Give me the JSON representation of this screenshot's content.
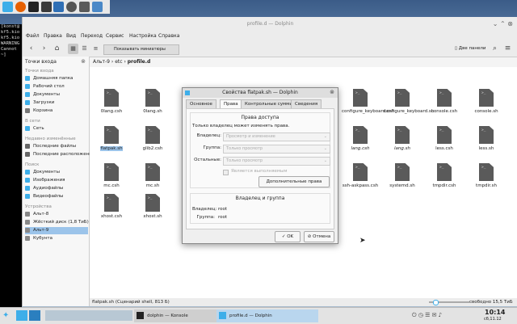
{
  "colors": {
    "accent": "#3daee9",
    "selection": "#9cc4ea",
    "file_icon": "#5a5a5a"
  },
  "konsole": {
    "lines": [
      "[konst@",
      "kf5.kio",
      "kf5.kio",
      "WARNING",
      "Cannot ",
      "~]"
    ]
  },
  "dolphin": {
    "title": "profile.d — Dolphin",
    "menu": [
      "Файл",
      "Правка",
      "Вид",
      "Переход",
      "Сервис",
      "Настройка",
      "Справка"
    ],
    "toolbar": {
      "show_preview": "Показывать миниатюры",
      "split": "Две панели"
    },
    "sidebar": {
      "places_header": "Точки входа",
      "places": [
        "Домашняя папка",
        "Рабочий стол",
        "Документы",
        "Загрузки",
        "Корзина"
      ],
      "network_header": "В сети",
      "network": [
        "Сеть"
      ],
      "recent_header": "Недавно изменённые",
      "recent": [
        "Последние файлы",
        "Последние расположения"
      ],
      "search_header": "Поиск",
      "search": [
        "Документы",
        "Изображения",
        "Аудиофайлы",
        "Видеофайлы"
      ],
      "devices_header": "Устройства",
      "devices": [
        "Альт-8",
        "Жёсткий диск (1,8 ТиБ)",
        "Альт-9",
        "Кубунта"
      ]
    },
    "breadcrumb": [
      "Альт-9",
      "etc",
      "profile.d"
    ],
    "files_row1": [
      "0lang.csh",
      "0lang.sh",
      "",
      "",
      "",
      "",
      "configure_keyboard.csh",
      "configure_keyboard.sh",
      "console.csh",
      "console.sh"
    ],
    "files_row2": [
      "flatpak.sh",
      "glib2.csh",
      "",
      "",
      "",
      "",
      "lang.csh",
      "lang.sh",
      "less.csh",
      "less.sh"
    ],
    "files_row3": [
      "mc.csh",
      "mc.sh",
      "",
      "",
      "",
      "",
      "ssh-askpass.csh",
      "systemd.sh",
      "tmpdir.csh",
      "tmpdir.sh"
    ],
    "files_row4": [
      "xhost.csh",
      "xhost.sh"
    ],
    "status_left": "flatpak.sh (Сценарий shell, 813 Б)",
    "status_right": "свободно 15,5 ТиБ"
  },
  "dialog": {
    "title": "Свойства flatpak.sh — Dolphin",
    "tabs": [
      "Основное",
      "Права",
      "Контрольные суммы",
      "Сведения"
    ],
    "access_header": "Права доступа",
    "note": "Только владелец может изменять права.",
    "owner_label": "Владелец:",
    "owner_value": "Просмотр и изменение",
    "group_label": "Группа:",
    "group_value": "Только просмотр",
    "others_label": "Остальные:",
    "others_value": "Только просмотр",
    "exec_label": "Является выполняемым",
    "advanced_btn": "Дополнительные права",
    "owner_header": "Владелец и группа",
    "owner_line_label": "Владелец:",
    "owner_line_value": "root",
    "group_line_label": "Группа:",
    "group_line_value": "root",
    "ok": "OK",
    "cancel": "Отмена"
  },
  "taskbar": {
    "konsole_task": "dolphin — Konsole",
    "dolphin_task": "profile.d — Dolphin",
    "time": "10:14",
    "date": "сб,11.12"
  }
}
